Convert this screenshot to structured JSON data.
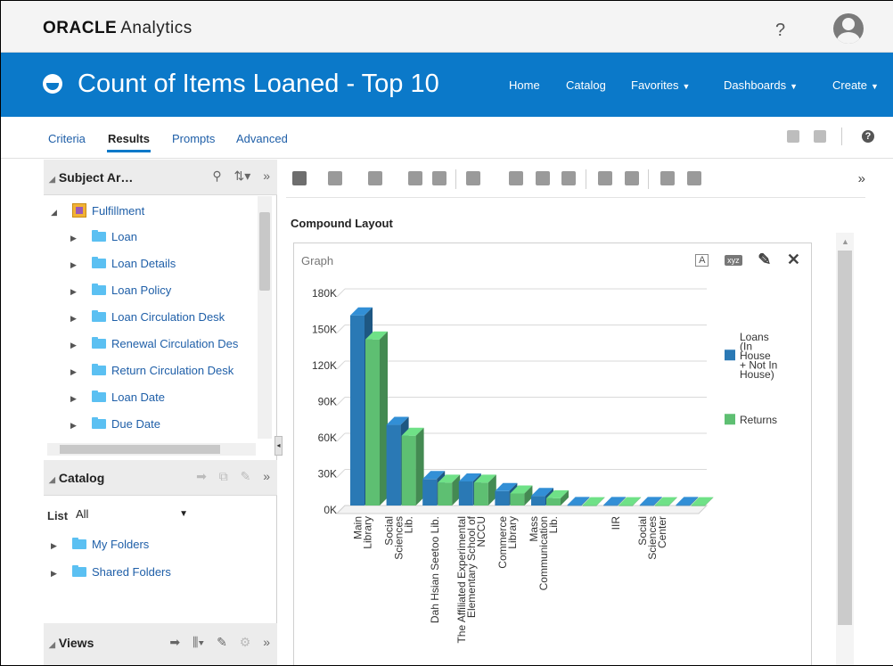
{
  "brand": {
    "logo_bold": "ORACLE",
    "logo_product": "Analytics",
    "help_glyph": "?"
  },
  "title_bar": {
    "title": "Count of Items Loaned - Top 10",
    "nav": [
      {
        "label": "Home",
        "has_caret": false
      },
      {
        "label": "Catalog",
        "has_caret": false
      },
      {
        "label": "Favorites",
        "has_caret": true
      },
      {
        "label": "Dashboards",
        "has_caret": true
      },
      {
        "label": "Create",
        "has_caret": true
      }
    ]
  },
  "tabs": [
    {
      "label": "Criteria",
      "active": false
    },
    {
      "label": "Results",
      "active": true
    },
    {
      "label": "Prompts",
      "active": false
    },
    {
      "label": "Advanced",
      "active": false
    }
  ],
  "subject_area": {
    "title": "Subject Ar…",
    "root": "Fulfillment",
    "items": [
      "Loan",
      "Loan Details",
      "Loan Policy",
      "Loan Circulation Desk",
      "Renewal Circulation Des",
      "Return Circulation Desk",
      "Loan Date",
      "Due Date"
    ]
  },
  "catalog": {
    "title": "Catalog",
    "list_label": "List",
    "list_value": "All",
    "folders": [
      "My Folders",
      "Shared Folders"
    ]
  },
  "views": {
    "title": "Views"
  },
  "results": {
    "compound_layout": "Compound Layout",
    "graph_label": "Graph",
    "graph_tool_text": "A",
    "graph_tool_xyz": "xyz"
  },
  "icons": {
    "toolbar": [
      "print-icon",
      "export-icon",
      "copy-icon",
      "format-icon",
      "refresh-icon",
      "view-type-icon",
      "add-view-icon",
      "filter-icon",
      "new-view-icon",
      "xyz-icon",
      "title-icon",
      "layout-icon",
      "columns-icon",
      "more-icon"
    ],
    "colors": {
      "brand_blue": "#0b79c9",
      "series1": "#2a79b5",
      "series2": "#5ebf72"
    }
  },
  "chart_data": {
    "type": "bar",
    "categories": [
      "Main Library",
      "Social Sciences Lib.",
      "Dah Hsian Seetoo Lib.",
      "The Affiliated Experimental Elementary School of NCCU",
      "Commerce Library",
      "Mass Communication Lib.",
      "",
      "IIR",
      "Social Sciences Center",
      ""
    ],
    "category_lines": [
      [
        "Main",
        "Library"
      ],
      [
        "Social",
        "Sciences",
        "Lib."
      ],
      [
        "Dah Hsian Seetoo Lib."
      ],
      [
        "The Affiliated Experimental",
        "Elementary School of",
        "NCCU"
      ],
      [
        "Commerce",
        "Library"
      ],
      [
        "Mass",
        "Communication",
        "Lib."
      ],
      [],
      [
        "IIR"
      ],
      [
        "Social",
        "Sciences",
        "Center"
      ],
      []
    ],
    "series": [
      {
        "name": "Loans (In House + Not In House)",
        "legend_lines": [
          "Loans",
          "(In",
          "House",
          "+ Not In",
          "House)"
        ],
        "color": "#2a79b5",
        "values": [
          158000,
          67000,
          22000,
          20000,
          12000,
          8000,
          500,
          500,
          500,
          500
        ]
      },
      {
        "name": "Returns",
        "legend_lines": [
          "Returns"
        ],
        "color": "#5ebf72",
        "values": [
          138000,
          58000,
          19000,
          19000,
          10000,
          6000,
          300,
          300,
          300,
          300
        ]
      }
    ],
    "yticks": [
      "0K",
      "30K",
      "60K",
      "90K",
      "120K",
      "150K",
      "180K"
    ],
    "ylim": [
      0,
      180000
    ],
    "xlabel": "",
    "ylabel": "",
    "legend_position": "right",
    "grid": true
  }
}
